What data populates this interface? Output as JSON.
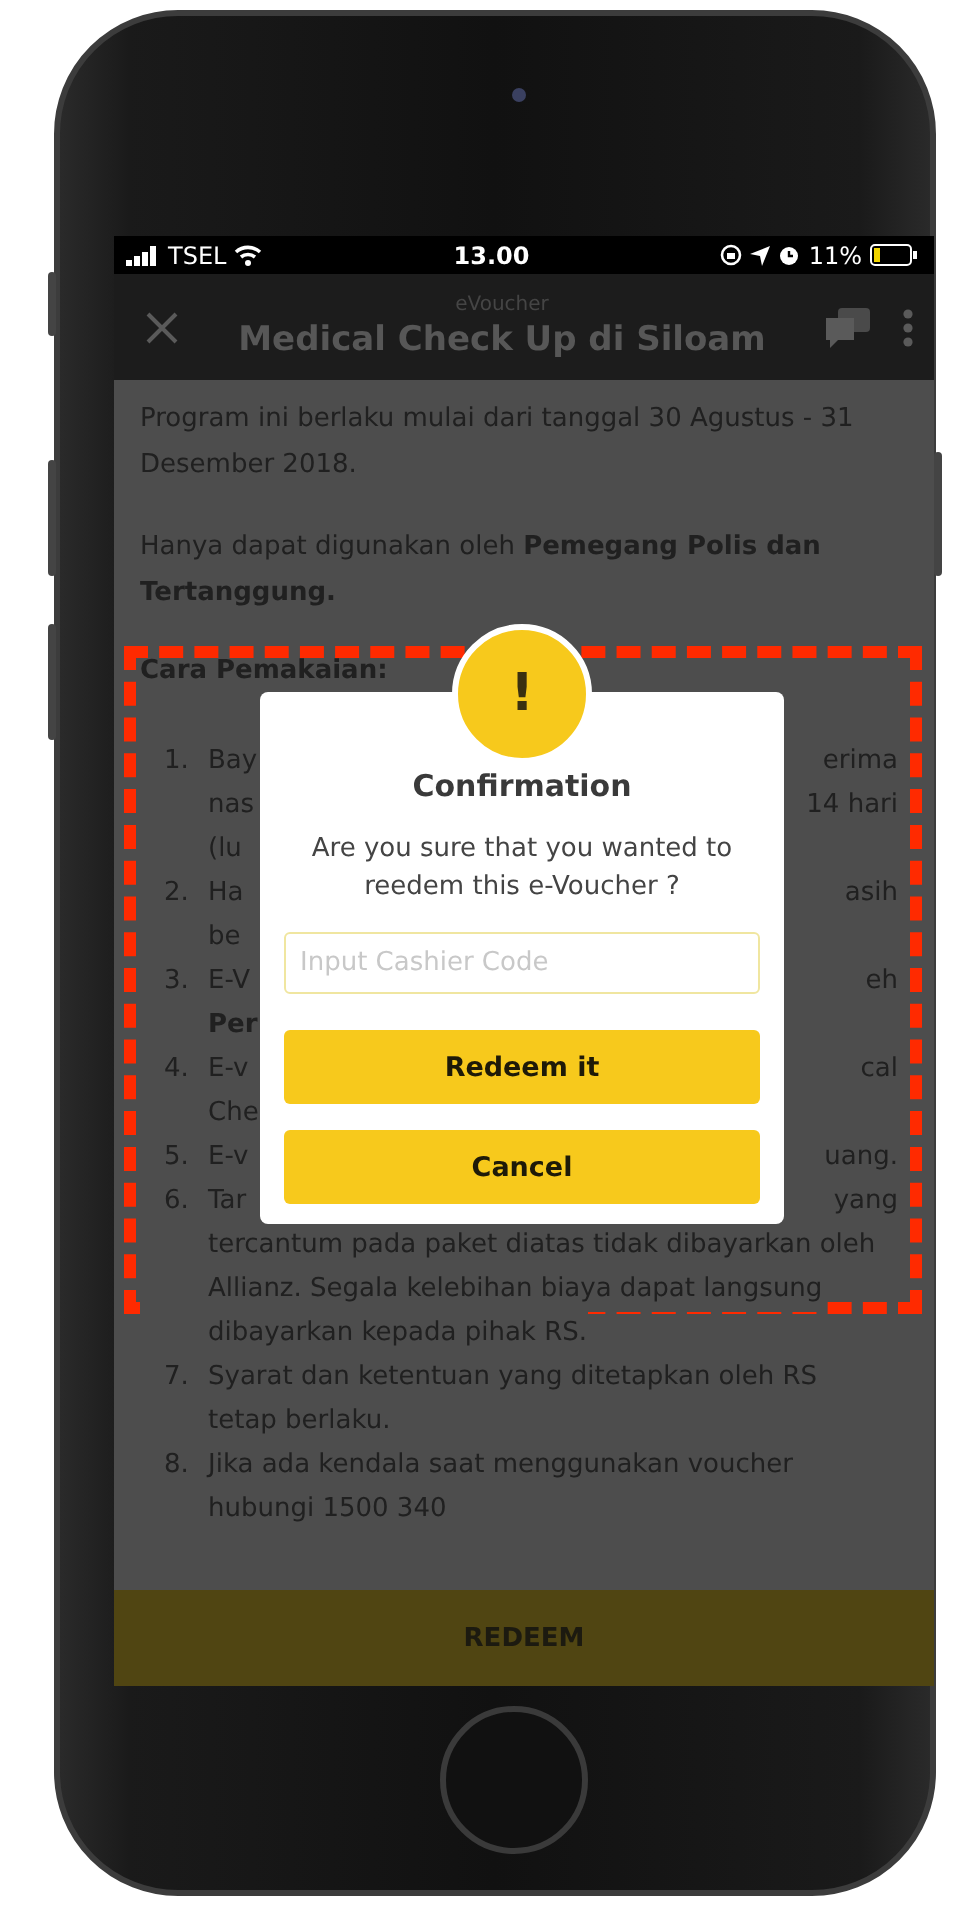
{
  "status_bar": {
    "carrier": "TSEL",
    "time": "13.00",
    "battery_text": "11%"
  },
  "header": {
    "subtitle": "eVoucher",
    "title": "Medical Check Up di Siloam"
  },
  "content": {
    "paragraphs": [
      "Program ini berlaku mulai dari tanggal 30 Agustus  - 31 Desember 2018.",
      "Hanya dapat digunakan oleh **Pemegang Polis dan Tertanggung.**"
    ],
    "heading": "Cara Pemakaian:",
    "items": [
      {
        "number": "1.",
        "lines": [
          {
            "left": "Bay",
            "right": "erima"
          },
          {
            "left": "nas",
            "right": "14 hari"
          },
          {
            "left": "(lu"
          }
        ]
      },
      {
        "number": "2.",
        "lines": [
          {
            "left": "Ha",
            "right": "asih"
          },
          {
            "left": "be"
          }
        ]
      },
      {
        "number": "3.",
        "lines": [
          {
            "left": "E-V",
            "right": "eh"
          },
          {
            "left": "Per",
            "bold": true
          }
        ]
      },
      {
        "number": "4.",
        "lines": [
          {
            "left": "E-v",
            "right": "cal"
          },
          {
            "left": "Che"
          }
        ]
      },
      {
        "number": "5.",
        "lines": [
          {
            "left": "E-v",
            "right": "uang."
          }
        ]
      },
      {
        "number": "6.",
        "lines": [
          {
            "left": "Tar",
            "right": "yang"
          },
          {
            "left": "tercantum pada paket diatas tidak dibayarkan oleh"
          },
          {
            "left": "Allianz. Segala kelebihan biaya dapat langsung"
          },
          {
            "left": "dibayarkan kepada pihak RS."
          }
        ]
      },
      {
        "number": "7.",
        "lines": [
          {
            "left": "Syarat dan ketentuan yang ditetapkan oleh RS"
          },
          {
            "left": "tetap berlaku."
          }
        ]
      },
      {
        "number": "8.",
        "lines": [
          {
            "left": "Jika ada kendala saat menggunakan voucher"
          },
          {
            "left": "hubungi 1500 340"
          }
        ]
      }
    ]
  },
  "bottom_button": "REDEEM",
  "dialog": {
    "icon_text": "!",
    "title": "Confirmation",
    "message": "Are you sure that you wanted to reedem this e-Voucher ?",
    "input": {
      "placeholder": "Input Cashier Code"
    },
    "buttons": [
      "Redeem it",
      "Cancel"
    ]
  }
}
